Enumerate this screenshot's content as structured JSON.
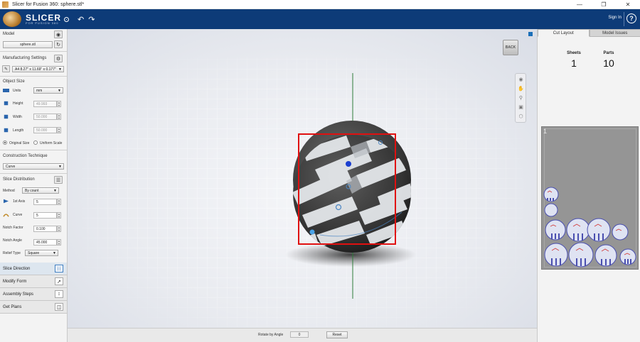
{
  "window": {
    "title": "Slicer for Fusion 360: sphere.stl*",
    "controls": [
      "minimize",
      "maximize",
      "close"
    ]
  },
  "header": {
    "logo_main": "SLICER",
    "logo_sub": "FOR FUSION 360",
    "sign_in": "Sign In",
    "help": "?"
  },
  "left_panel": {
    "model": {
      "title": "Model",
      "file": "sphere.stl"
    },
    "manufacturing": {
      "title": "Manufacturing Settings",
      "sheet": "A4 8.27\" x 11.69\" x 0.177\""
    },
    "object_size": {
      "title": "Object Size",
      "units_label": "Units",
      "units_value": "mm",
      "height_label": "Height",
      "height_value": "49.993",
      "width_label": "Width",
      "width_value": "50.000",
      "length_label": "Length",
      "length_value": "50.000",
      "original_size": "Original Size",
      "uniform_scale": "Uniform Scale"
    },
    "construction": {
      "title": "Construction Technique",
      "value": "Curve"
    },
    "slice_distribution": {
      "title": "Slice Distribution",
      "method_label": "Method",
      "method_value": "By count",
      "axis1_label": "1st Axis",
      "axis1_value": "5",
      "curve_label": "Curve",
      "curve_value": "5",
      "notch_factor_label": "Notch Factor",
      "notch_factor_value": "0.100",
      "notch_angle_label": "Notch Angle",
      "notch_angle_value": "45.000",
      "relief_label": "Relief Type",
      "relief_value": "Square"
    },
    "nav": [
      "Slice Direction",
      "Modify Form",
      "Assembly Steps",
      "Get Plans"
    ]
  },
  "viewport": {
    "back": "BACK",
    "rotate_label": "Rotate by  Angle",
    "rotate_value": "0",
    "reset": "Reset"
  },
  "right_panel": {
    "tabs": [
      "Cut Layout",
      "Model Issues"
    ],
    "sheets_label": "Sheets",
    "sheets_value": "1",
    "parts_label": "Parts",
    "parts_value": "10",
    "sheet_number": "1"
  },
  "colors": {
    "header_bg": "#0d3b78",
    "selection_box": "#e01010",
    "accent": "#1b6fb8"
  }
}
